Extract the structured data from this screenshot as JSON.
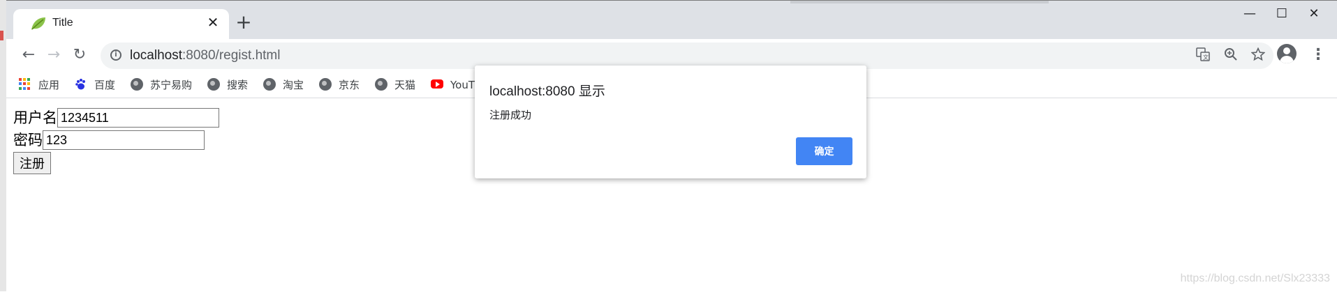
{
  "browser": {
    "tab_title": "Title",
    "tab_close": "✕",
    "new_tab": "+",
    "window_controls": {
      "minimize": "—",
      "maximize": "☐",
      "close": "✕"
    },
    "nav": {
      "back": "←",
      "forward": "→",
      "reload": "↻"
    },
    "url_host": "localhost",
    "url_rest": ":8080/regist.html",
    "omnibox_icons": [
      "translate-icon",
      "zoom-icon",
      "star-icon"
    ],
    "menu": "⋮"
  },
  "bookmarks": [
    {
      "label": "应用",
      "icon": "apps-icon"
    },
    {
      "label": "百度",
      "icon": "baidu-paw-icon"
    },
    {
      "label": "苏宁易购",
      "icon": "globe-icon"
    },
    {
      "label": "搜索",
      "icon": "globe-icon"
    },
    {
      "label": "淘宝",
      "icon": "globe-icon"
    },
    {
      "label": "京东",
      "icon": "globe-icon"
    },
    {
      "label": "天猫",
      "icon": "globe-icon"
    },
    {
      "label": "YouT",
      "icon": "youtube-icon"
    }
  ],
  "form": {
    "username_label": "用户名",
    "username_value": "1234511",
    "password_label": "密码",
    "password_value": "123",
    "submit_label": "注册"
  },
  "dialog": {
    "title": "localhost:8080 显示",
    "message": "注册成功",
    "ok_label": "确定"
  },
  "watermark": "https://blog.csdn.net/Slx23333",
  "colors": {
    "accent": "#4285f4",
    "tabstrip": "#dee1e6",
    "omnibox": "#f1f3f4"
  }
}
